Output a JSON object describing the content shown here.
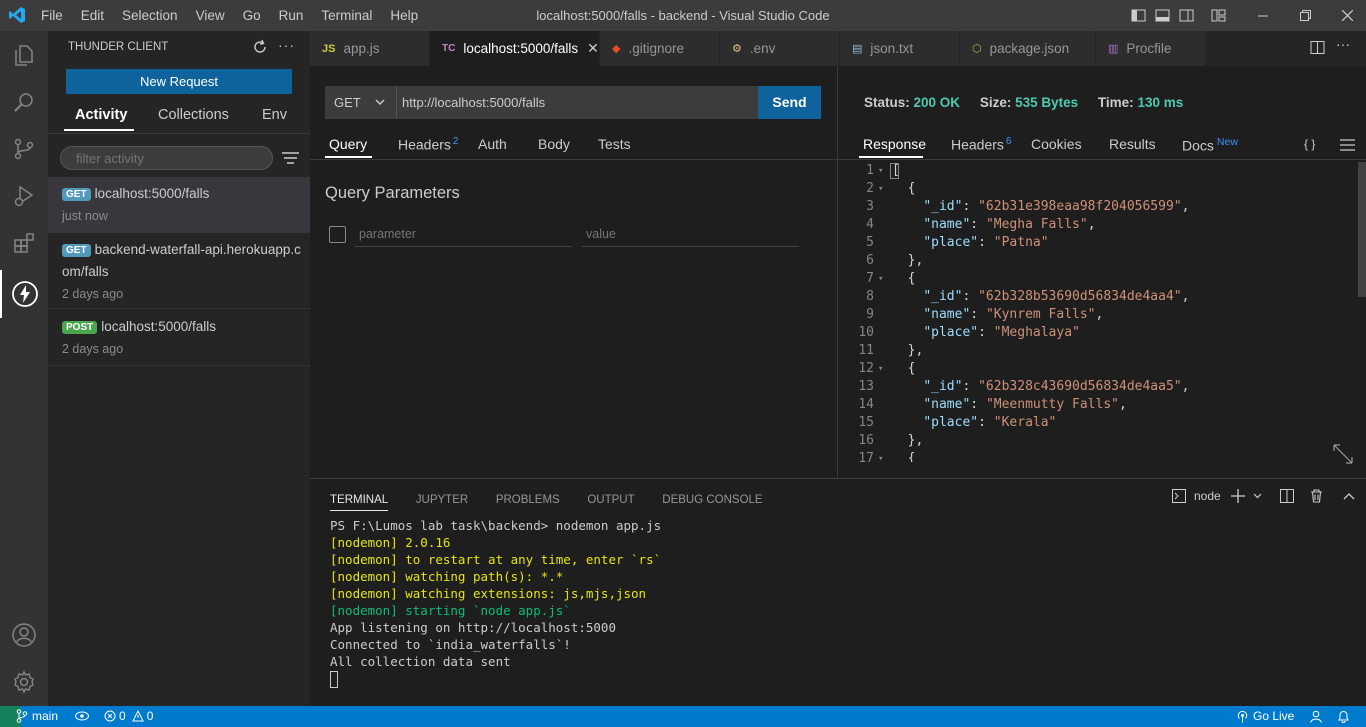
{
  "titlebar": {
    "title": "localhost:5000/falls - backend - Visual Studio Code",
    "menu": [
      "File",
      "Edit",
      "Selection",
      "View",
      "Go",
      "Run",
      "Terminal",
      "Help"
    ]
  },
  "sidebar": {
    "title": "THUNDER CLIENT",
    "new_request_label": "New Request",
    "tabs": [
      "Activity",
      "Collections",
      "Env"
    ],
    "filter_placeholder": "filter activity",
    "history": [
      {
        "method": "GET",
        "url": "localhost:5000/falls",
        "time": "just now"
      },
      {
        "method": "GET",
        "url_line1": "backend-waterfall-api.herokuapp.c",
        "url_line2": "om/falls",
        "time": "2 days ago"
      },
      {
        "method": "POST",
        "url": "localhost:5000/falls",
        "time": "2 days ago"
      }
    ]
  },
  "tabs": [
    {
      "icon": "JS",
      "label": "app.js"
    },
    {
      "icon": "TC",
      "label": "localhost:5000/falls"
    },
    {
      "icon": "◆",
      "label": ".gitignore"
    },
    {
      "icon": "⚙",
      "label": ".env"
    },
    {
      "icon": "▤",
      "label": "json.txt"
    },
    {
      "icon": "⬡",
      "label": "package.json"
    },
    {
      "icon": "▥",
      "label": "Procfile"
    }
  ],
  "request": {
    "method": "GET",
    "url": "http://localhost:5000/falls",
    "send_label": "Send",
    "tabs": [
      "Query",
      "Headers",
      "Auth",
      "Body",
      "Tests"
    ],
    "headers_count": "2",
    "query_title": "Query Parameters",
    "param_placeholder": "parameter",
    "value_placeholder": "value"
  },
  "response": {
    "status_label": "Status:",
    "status_value": "200 OK",
    "size_label": "Size:",
    "size_value": "535 Bytes",
    "time_label": "Time:",
    "time_value": "130 ms",
    "tabs": [
      "Response",
      "Headers",
      "Cookies",
      "Results",
      "Docs"
    ],
    "headers_count": "6",
    "docs_badge": "New",
    "braces": "{ }",
    "lines": [
      {
        "n": "1",
        "fold": true,
        "text": "["
      },
      {
        "n": "2",
        "fold": true,
        "text": "  {"
      },
      {
        "n": "3",
        "key": "\"_id\"",
        "val": "\"62b31e398eaa98f204056599\"",
        "trail": ","
      },
      {
        "n": "4",
        "key": "\"name\"",
        "val": "\"Megha Falls\"",
        "trail": ","
      },
      {
        "n": "5",
        "key": "\"place\"",
        "val": "\"Patna\"",
        "trail": ""
      },
      {
        "n": "6",
        "fold": false,
        "text": "  },"
      },
      {
        "n": "7",
        "fold": true,
        "text": "  {"
      },
      {
        "n": "8",
        "key": "\"_id\"",
        "val": "\"62b328b53690d56834de4aa4\"",
        "trail": ","
      },
      {
        "n": "9",
        "key": "\"name\"",
        "val": "\"Kynrem Falls\"",
        "trail": ","
      },
      {
        "n": "10",
        "key": "\"place\"",
        "val": "\"Meghalaya\"",
        "trail": ""
      },
      {
        "n": "11",
        "fold": false,
        "text": "  },"
      },
      {
        "n": "12",
        "fold": true,
        "text": "  {"
      },
      {
        "n": "13",
        "key": "\"_id\"",
        "val": "\"62b328c43690d56834de4aa5\"",
        "trail": ","
      },
      {
        "n": "14",
        "key": "\"name\"",
        "val": "\"Meenmutty Falls\"",
        "trail": ","
      },
      {
        "n": "15",
        "key": "\"place\"",
        "val": "\"Kerala\"",
        "trail": ""
      },
      {
        "n": "16",
        "fold": false,
        "text": "  },"
      },
      {
        "n": "17",
        "fold": true,
        "text": "  {"
      }
    ]
  },
  "panel": {
    "tabs": [
      "TERMINAL",
      "JUPYTER",
      "PROBLEMS",
      "OUTPUT",
      "DEBUG CONSOLE"
    ],
    "shell_label": "node",
    "terminal_lines": [
      {
        "text": "PS F:\\Lumos lab task\\backend> nodemon app.js",
        "color": "#cccccc"
      },
      {
        "text": "[nodemon] 2.0.16",
        "color": "#e5e510"
      },
      {
        "text": "[nodemon] to restart at any time, enter `rs`",
        "color": "#e5e510"
      },
      {
        "text": "[nodemon] watching path(s): *.*",
        "color": "#e5e510"
      },
      {
        "text": "[nodemon] watching extensions: js,mjs,json",
        "color": "#e5e510"
      },
      {
        "text": "[nodemon] starting `node app.js`",
        "color": "#0dbc79"
      },
      {
        "text": "App listening on http://localhost:5000",
        "color": "#cccccc"
      },
      {
        "text": "Connected to `india_waterfalls`!",
        "color": "#cccccc"
      },
      {
        "text": "All collection data sent",
        "color": "#cccccc"
      }
    ]
  },
  "statusbar": {
    "branch": "main",
    "errors": "0",
    "warnings": "0",
    "go_live": "Go Live"
  },
  "colors": {
    "accent": "#007acc",
    "button": "#0e639c",
    "status_ok": "#4ec9b0",
    "badge_get": "#519aba",
    "badge_post": "#49a84e"
  }
}
